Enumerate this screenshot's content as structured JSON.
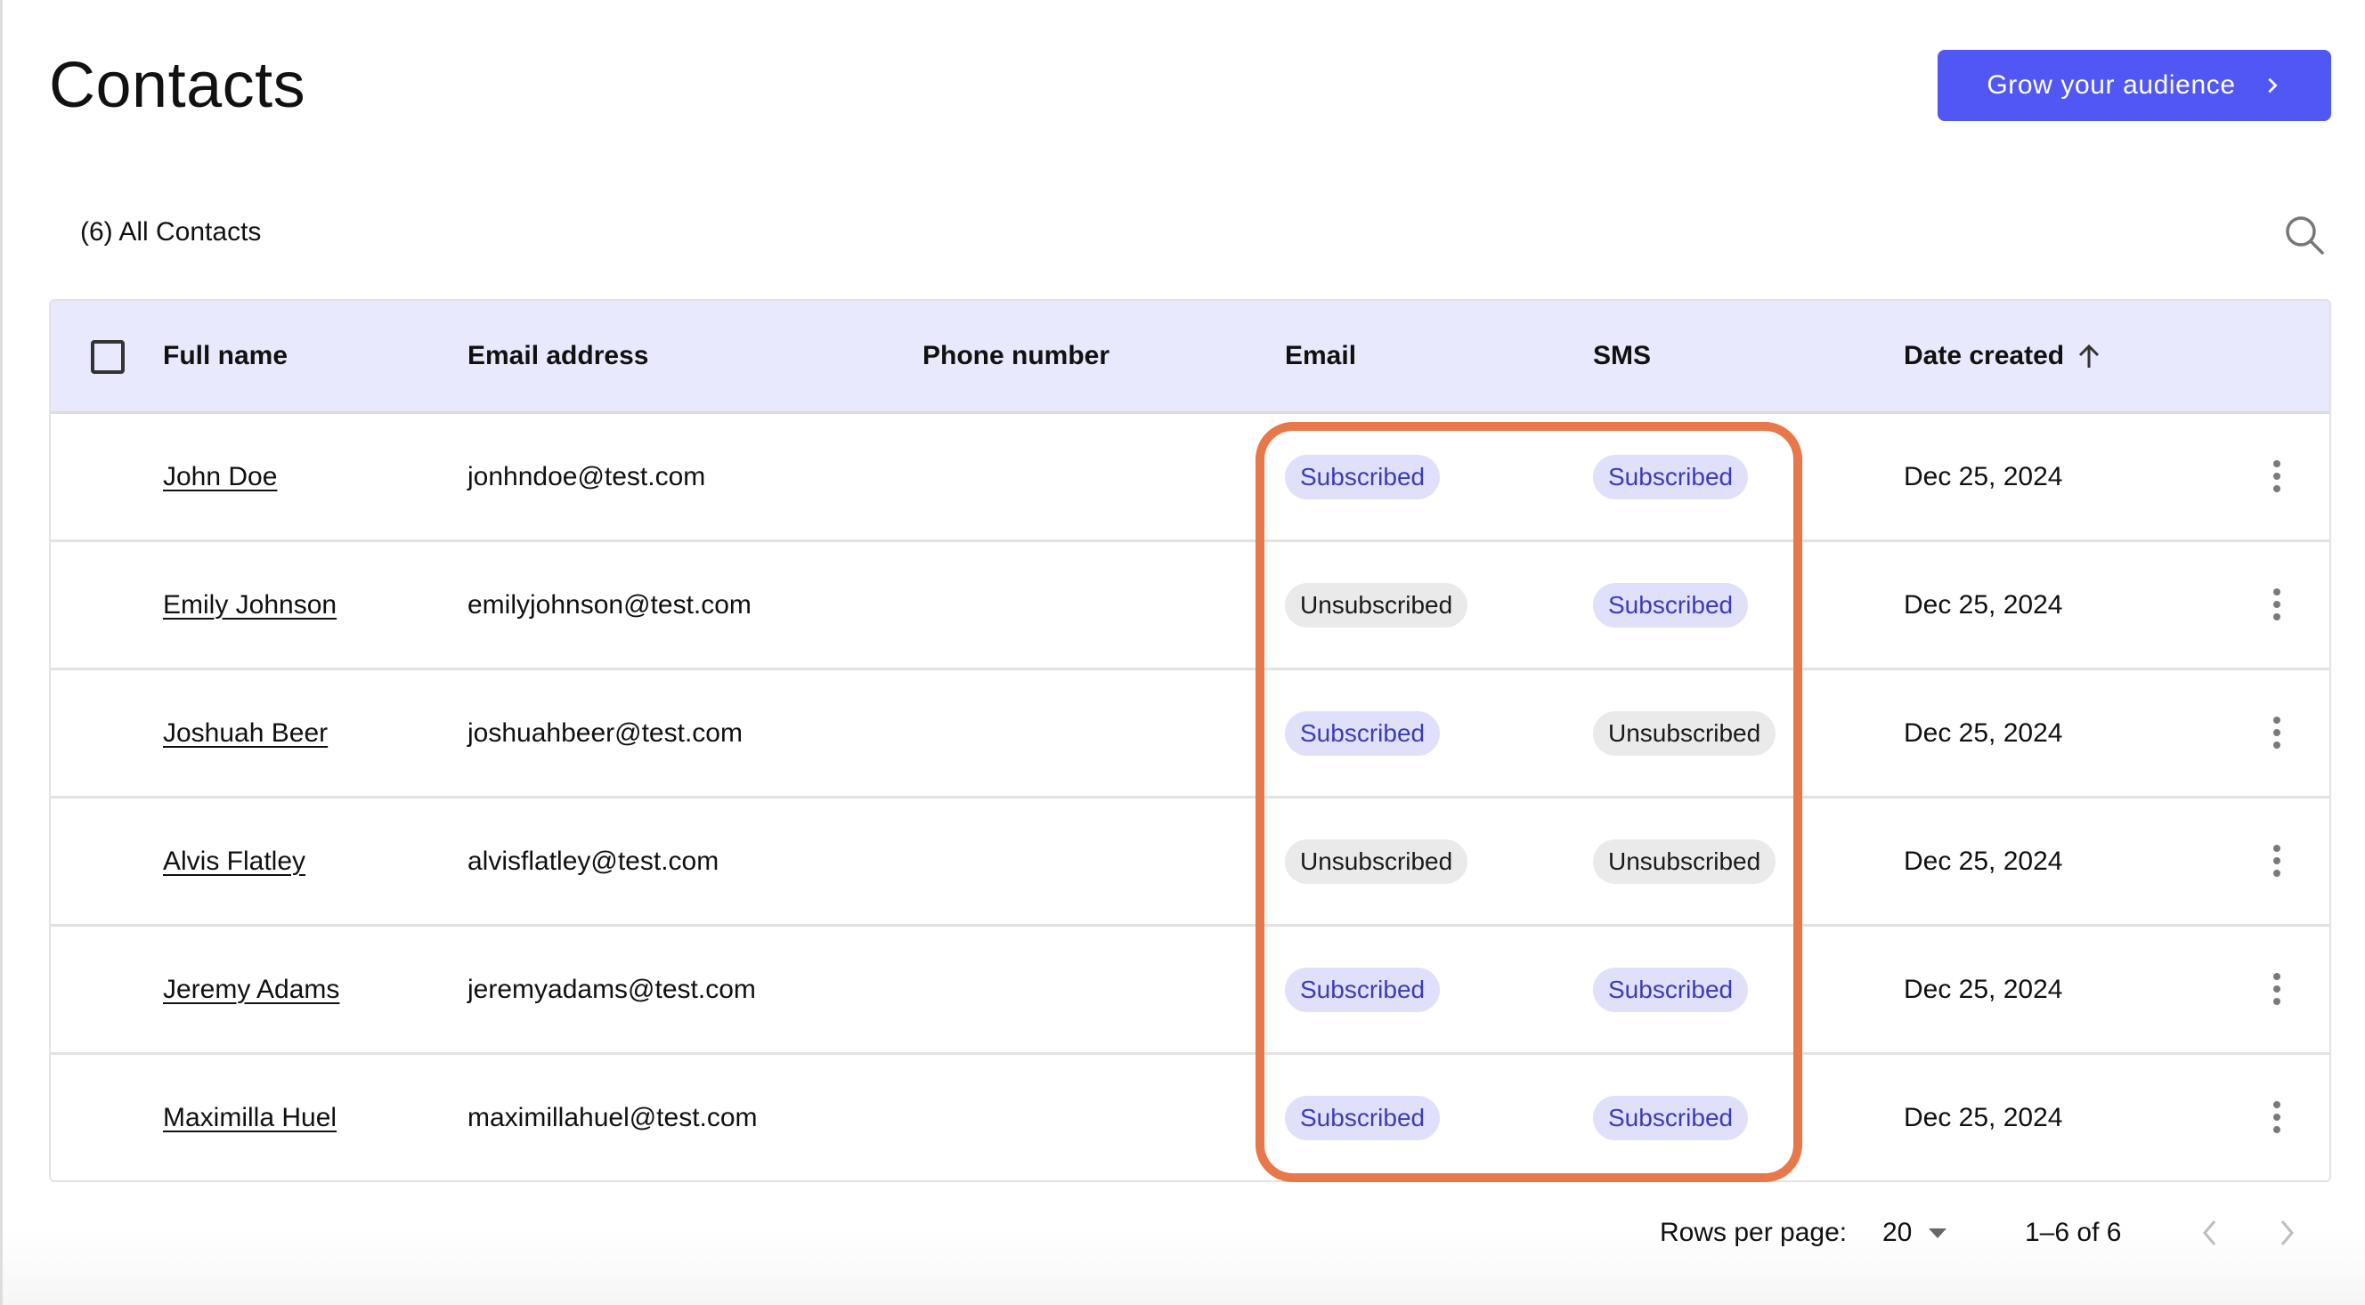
{
  "page": {
    "title": "Contacts",
    "cta_label": "Grow your audience",
    "cta_icon": "chevron-right-icon",
    "count_label": "(6) All Contacts",
    "search_icon": "search-icon"
  },
  "colors": {
    "primary": "#5057F5",
    "header_bg": "#E8E9FC",
    "chip_subscribed_bg": "#E0E0FB",
    "chip_subscribed_text": "#3B3DB5",
    "chip_unsubscribed_bg": "#EAEAEA",
    "highlight": "#E8774A"
  },
  "table": {
    "columns": {
      "full_name": "Full name",
      "email_address": "Email address",
      "phone_number": "Phone number",
      "email": "Email",
      "sms": "SMS",
      "date_created": "Date created"
    },
    "sort": {
      "column": "date_created",
      "direction": "ascending",
      "icon": "arrow-up-icon"
    },
    "rows": [
      {
        "name": "John Doe",
        "email_address": "jonhndoe@test.com",
        "phone": "",
        "email_status": "Subscribed",
        "sms_status": "Subscribed",
        "date": "Dec 25, 2024"
      },
      {
        "name": "Emily Johnson",
        "email_address": "emilyjohnson@test.com",
        "phone": "",
        "email_status": "Unsubscribed",
        "sms_status": "Subscribed",
        "date": "Dec 25, 2024"
      },
      {
        "name": "Joshuah Beer",
        "email_address": "joshuahbeer@test.com",
        "phone": "",
        "email_status": "Subscribed",
        "sms_status": "Unsubscribed",
        "date": "Dec 25, 2024"
      },
      {
        "name": "Alvis Flatley",
        "email_address": "alvisflatley@test.com",
        "phone": "",
        "email_status": "Unsubscribed",
        "sms_status": "Unsubscribed",
        "date": "Dec 25, 2024"
      },
      {
        "name": "Jeremy Adams",
        "email_address": "jeremyadams@test.com",
        "phone": "",
        "email_status": "Subscribed",
        "sms_status": "Subscribed",
        "date": "Dec 25, 2024"
      },
      {
        "name": "Maximilla Huel",
        "email_address": "maximillahuel@test.com",
        "phone": "",
        "email_status": "Subscribed",
        "sms_status": "Subscribed",
        "date": "Dec 25, 2024"
      }
    ]
  },
  "pagination": {
    "rows_per_page_label": "Rows per page:",
    "rows_per_page_value": "20",
    "range_label": "1–6 of 6",
    "prev_enabled": false,
    "next_enabled": false
  }
}
